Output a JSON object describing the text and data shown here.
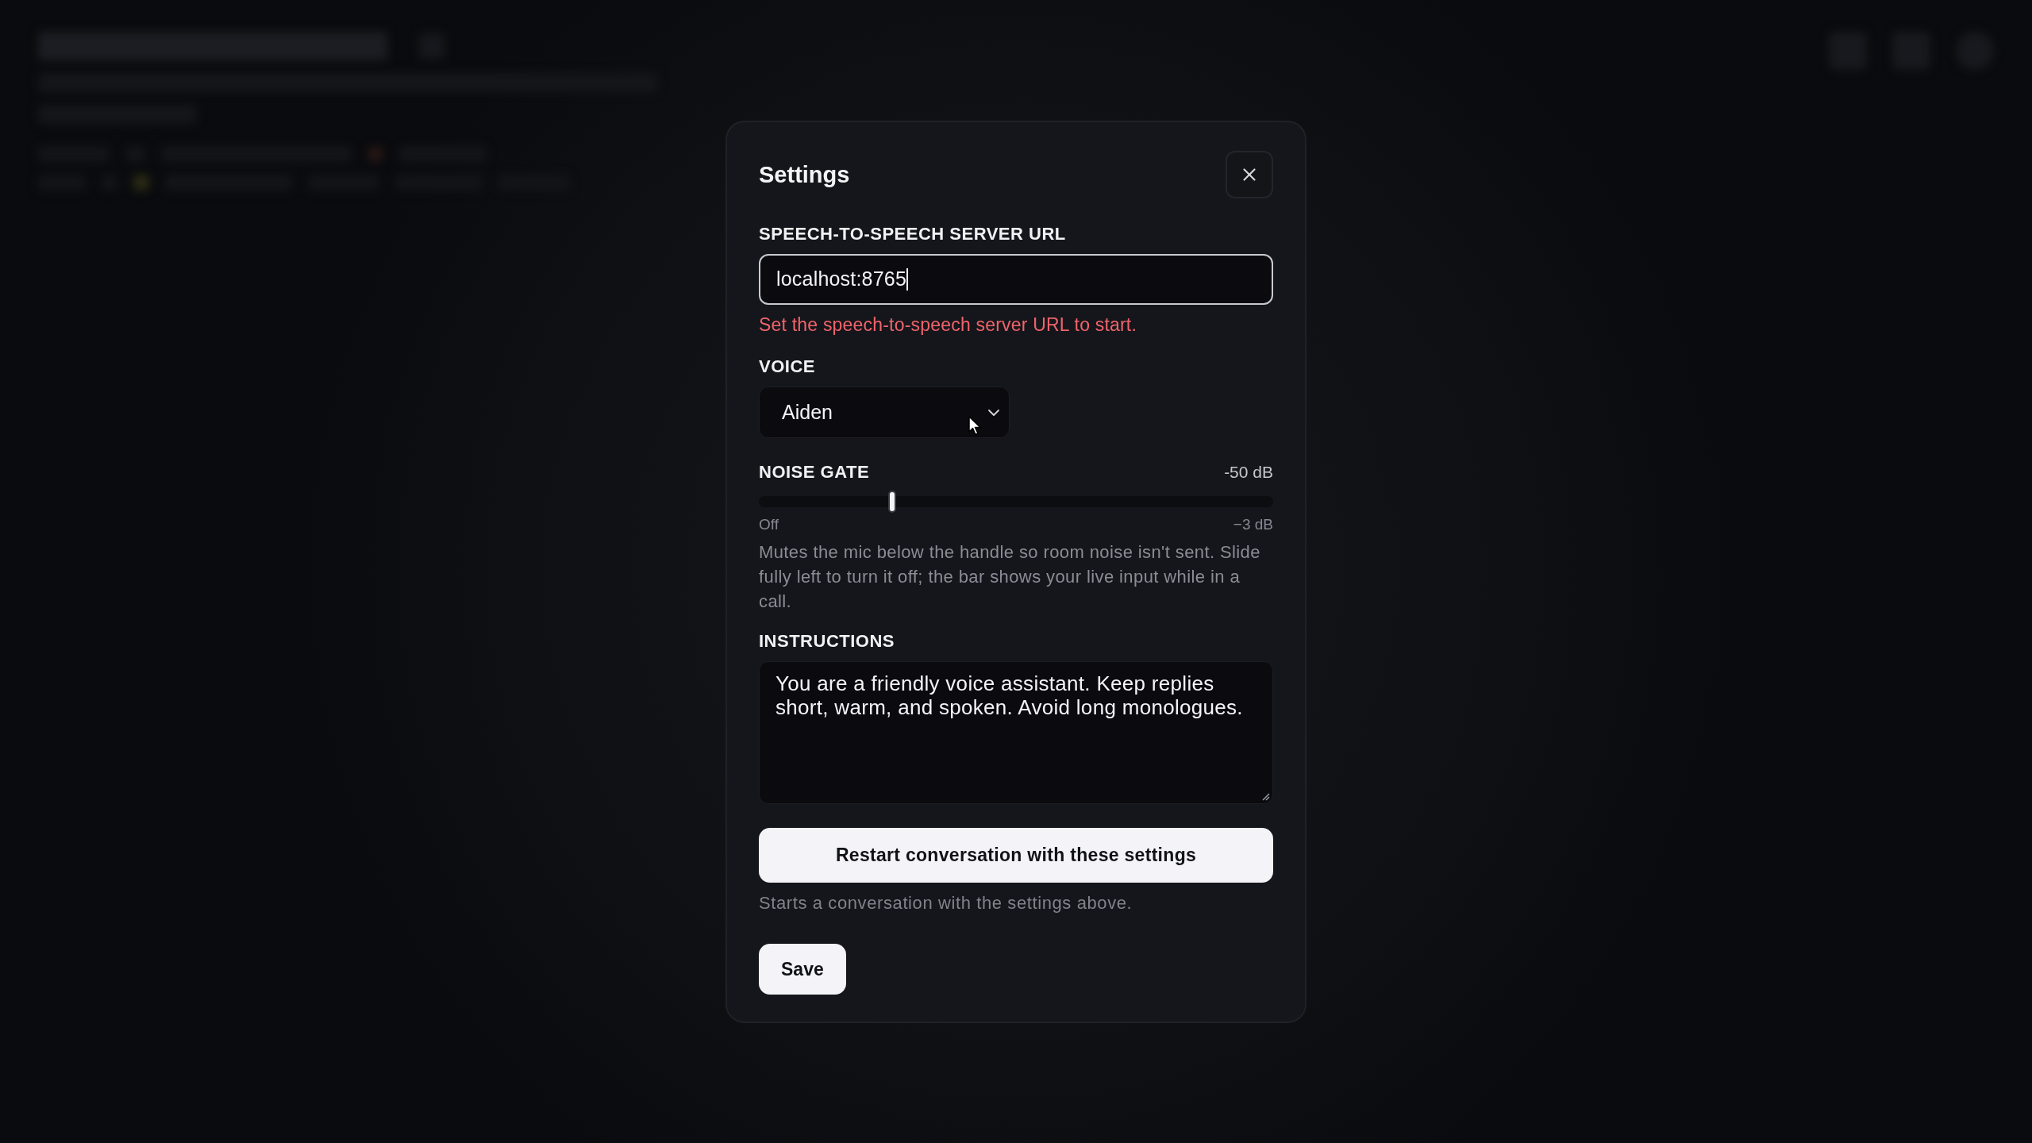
{
  "dialog": {
    "title": "Settings"
  },
  "server_url": {
    "label": "SPEECH-TO-SPEECH SERVER URL",
    "value": "localhost:8765",
    "error": "Set the speech-to-speech server URL to start."
  },
  "voice": {
    "label": "VOICE",
    "value": "Aiden"
  },
  "noise_gate": {
    "label": "NOISE GATE",
    "reading": "-50 dB",
    "level": 0.26,
    "min_label": "Off",
    "max_label": "−3 dB",
    "help": "Mutes the mic below the handle so room noise isn't sent. Slide fully left to turn it off; the bar shows your live input while in a call."
  },
  "instructions": {
    "label": "INSTRUCTIONS",
    "value": "You are a friendly voice assistant. Keep replies short, warm, and spoken. Avoid long monologues."
  },
  "restart_button": {
    "label": "Restart conversation with these settings",
    "help": "Starts a conversation with the settings above."
  },
  "save_button": {
    "label": "Save"
  }
}
